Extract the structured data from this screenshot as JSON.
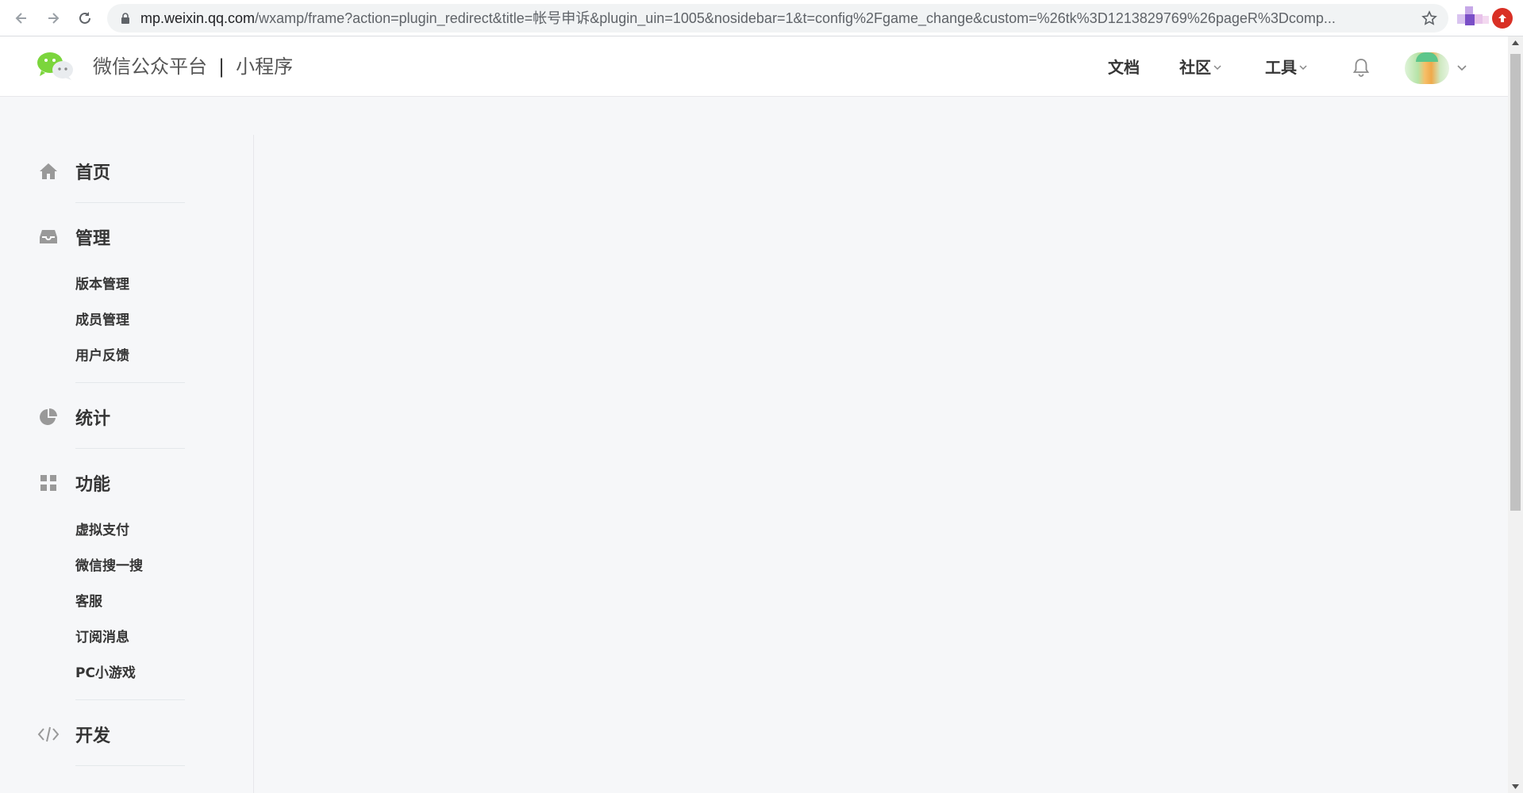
{
  "browser": {
    "url_host": "mp.weixin.qq.com",
    "url_path": "/wxamp/frame?action=plugin_redirect&title=帐号申诉&plugin_uin=1005&nosidebar=1&t=config%2Fgame_change&custom=%26tk%3D1213829769%26pageR%3Dcomp..."
  },
  "header": {
    "brand_name": "微信公众平台",
    "separator": "|",
    "product_name": "小程序",
    "nav": {
      "docs": "文档",
      "community": "社区",
      "tools": "工具"
    }
  },
  "sidebar": {
    "home": {
      "label": "首页",
      "icon": "home-icon"
    },
    "manage": {
      "label": "管理",
      "icon": "inbox-icon",
      "items": [
        "版本管理",
        "成员管理",
        "用户反馈"
      ]
    },
    "stats": {
      "label": "统计",
      "icon": "pie-chart-icon"
    },
    "features": {
      "label": "功能",
      "icon": "grid-icon",
      "items": [
        "虚拟支付",
        "微信搜一搜",
        "客服",
        "订阅消息",
        "PC小游戏"
      ]
    },
    "develop": {
      "label": "开发",
      "icon": "code-icon"
    }
  },
  "colors": {
    "page_bg": "#f6f7f9",
    "header_bg": "#ffffff",
    "wechat_green": "#7bd53c",
    "text_primary": "#353535",
    "icon_gray": "#999999"
  }
}
